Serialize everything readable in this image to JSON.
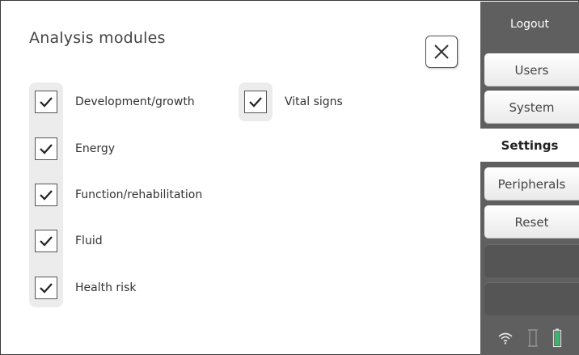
{
  "panel": {
    "title": "Analysis modules"
  },
  "modules": [
    {
      "label": "Development/growth",
      "checked": true
    },
    {
      "label": "Energy",
      "checked": true
    },
    {
      "label": "Function/rehabilitation",
      "checked": true
    },
    {
      "label": "Fluid",
      "checked": true
    },
    {
      "label": "Health risk",
      "checked": true
    },
    {
      "label": "Vital signs",
      "checked": true
    }
  ],
  "sidebar": {
    "logout_label": "Logout",
    "tabs": [
      {
        "label": "Users"
      },
      {
        "label": "System"
      },
      {
        "label": "Settings",
        "active": true
      },
      {
        "label": "Peripherals"
      },
      {
        "label": "Reset"
      }
    ]
  },
  "status": {
    "wifi": "wifi-icon",
    "device": "device-icon",
    "battery": "battery-icon",
    "battery_color": "#3cb371"
  }
}
